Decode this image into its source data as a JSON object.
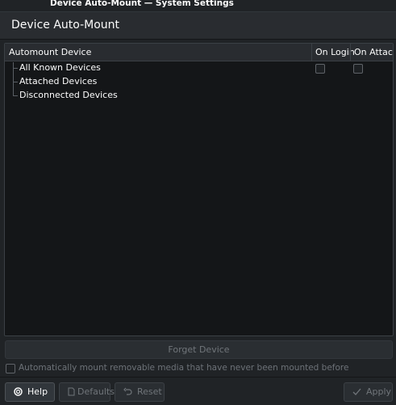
{
  "window": {
    "title": "Device Auto-Mount — System Settings"
  },
  "page": {
    "title": "Device Auto-Mount"
  },
  "table": {
    "columns": [
      "Automount Device",
      "On Login",
      "On Attach"
    ],
    "rows": [
      {
        "label": "All Known Devices",
        "on_login": false,
        "on_attach": false
      },
      {
        "label": "Attached Devices"
      },
      {
        "label": "Disconnected Devices"
      }
    ]
  },
  "actions": {
    "forget_label": "Forget Device"
  },
  "option": {
    "automount_label": "Automatically mount removable media that have never been mounted before",
    "checked": false
  },
  "footer": {
    "help": "Help",
    "defaults": "Defaults",
    "reset": "Reset",
    "apply": "Apply"
  },
  "icons": {
    "help": "lifebuoy-icon",
    "defaults": "document-icon",
    "reset": "undo-icon",
    "apply": "check-icon"
  },
  "colors": {
    "background": "#202326",
    "view": "#141618",
    "text": "#fcfcfc",
    "disabled_text": "#70757a"
  }
}
